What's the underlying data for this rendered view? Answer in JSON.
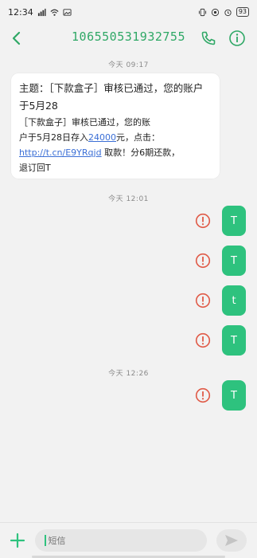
{
  "status_bar": {
    "time": "12:34",
    "battery": "93"
  },
  "header": {
    "title": "106550531932755"
  },
  "messages": {
    "time1": "今天 09:17",
    "incoming": {
      "subject": "主题：［下款盒子］审核已通过，您的账户于5月28",
      "line1": "［下款盒子］审核已通过，您的账",
      "line2_a": "户于5月28日存入",
      "amount": "24000",
      "line2_b": "元，点击：",
      "link": "http://t.cn/E9YRqjd",
      "line3_b": " 取款！分6期还款，",
      "line4": "退订回T"
    },
    "time2": "今天 12:01",
    "out1": "T",
    "out2": "T",
    "out3": "t",
    "out4": "T",
    "time3": "今天 12:26",
    "out5": "T"
  },
  "compose": {
    "placeholder": "短信"
  },
  "colors": {
    "accent": "#2ec27e",
    "title": "#2fa866",
    "error": "#e05a47"
  }
}
